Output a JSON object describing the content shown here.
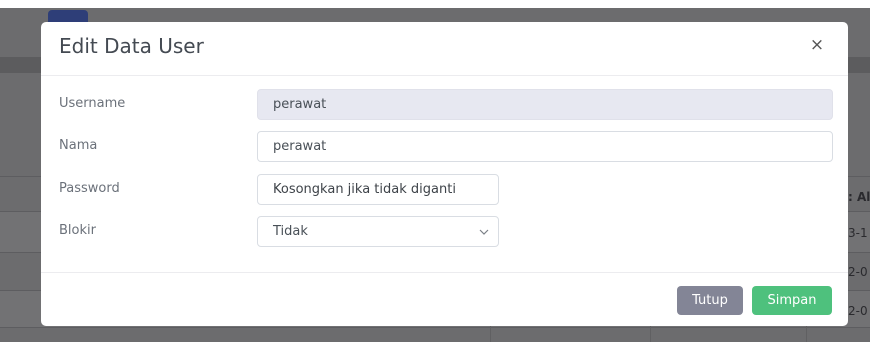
{
  "background": {
    "table_header_partial": ": Al",
    "row_cells_partial": [
      "3-1",
      "2-0",
      "2-0"
    ]
  },
  "modal": {
    "title": "Edit Data User",
    "close_symbol": "×",
    "fields": {
      "username": {
        "label": "Username",
        "value": "perawat",
        "readonly": true
      },
      "nama": {
        "label": "Nama",
        "value": "perawat"
      },
      "password": {
        "label": "Password",
        "value": "",
        "placeholder": "Kosongkan jika tidak diganti"
      },
      "blokir": {
        "label": "Blokir",
        "selected": "Tidak"
      }
    },
    "buttons": {
      "close_label": "Tutup",
      "save_label": "Simpan"
    }
  },
  "colors": {
    "overlay": "#6c6c6e",
    "close_button": "#838596",
    "save_button": "#4ec17d",
    "readonly_input": "#e7e8f1"
  },
  "icons": {
    "modal_close": "close-icon",
    "select_arrow": "chevron-down-icon"
  }
}
